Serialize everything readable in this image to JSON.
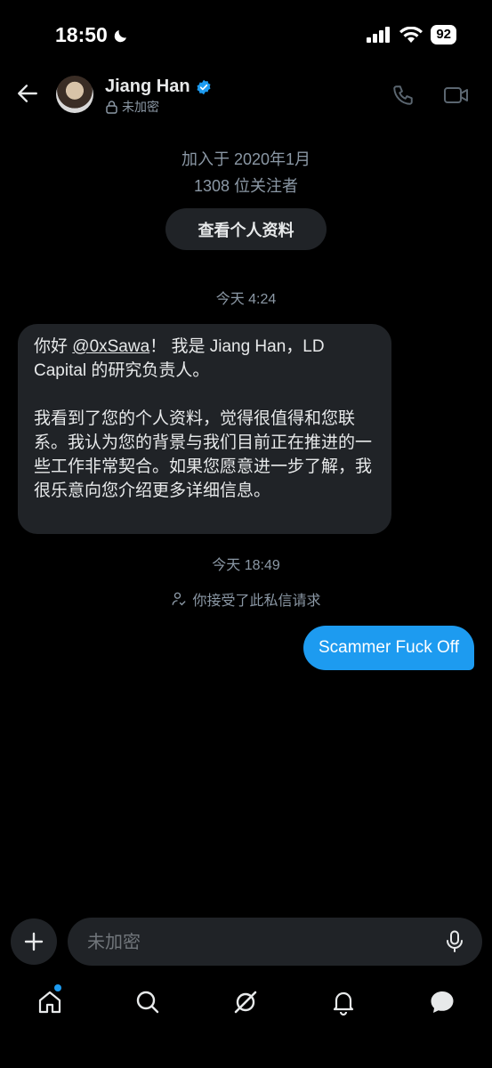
{
  "status_bar": {
    "time": "18:50",
    "battery": "92"
  },
  "header": {
    "name": "Jiang Han",
    "encryption": "未加密"
  },
  "profile_summary": {
    "joined": "加入于 2020年1月",
    "followers": "1308 位关注者",
    "view_profile": "查看个人资料"
  },
  "messages": {
    "ts1": "今天 4:24",
    "incoming": {
      "greeting_pre": "你好 ",
      "mention": "@0xSawa",
      "greeting_post": "！ 我是 Jiang Han，LD Capital 的研究负责人。",
      "paragraph2": "我看到了您的个人资料，觉得很值得和您联系。我认为您的背景与我们目前正在推进的一些工作非常契合。如果您愿意进一步了解，我很乐意向您介绍更多详细信息。"
    },
    "ts2": "今天 18:49",
    "accepted_notice": "你接受了此私信请求",
    "outgoing": "Scammer Fuck Off"
  },
  "composer": {
    "placeholder": "未加密"
  },
  "tabbar": {
    "items": [
      "home-icon",
      "search-icon",
      "grok-icon",
      "bell-icon",
      "messages-icon"
    ],
    "home_has_notification": true
  },
  "colors": {
    "accent": "#1d9bf0",
    "bubble": "#202327",
    "muted": "#8b98a5"
  }
}
